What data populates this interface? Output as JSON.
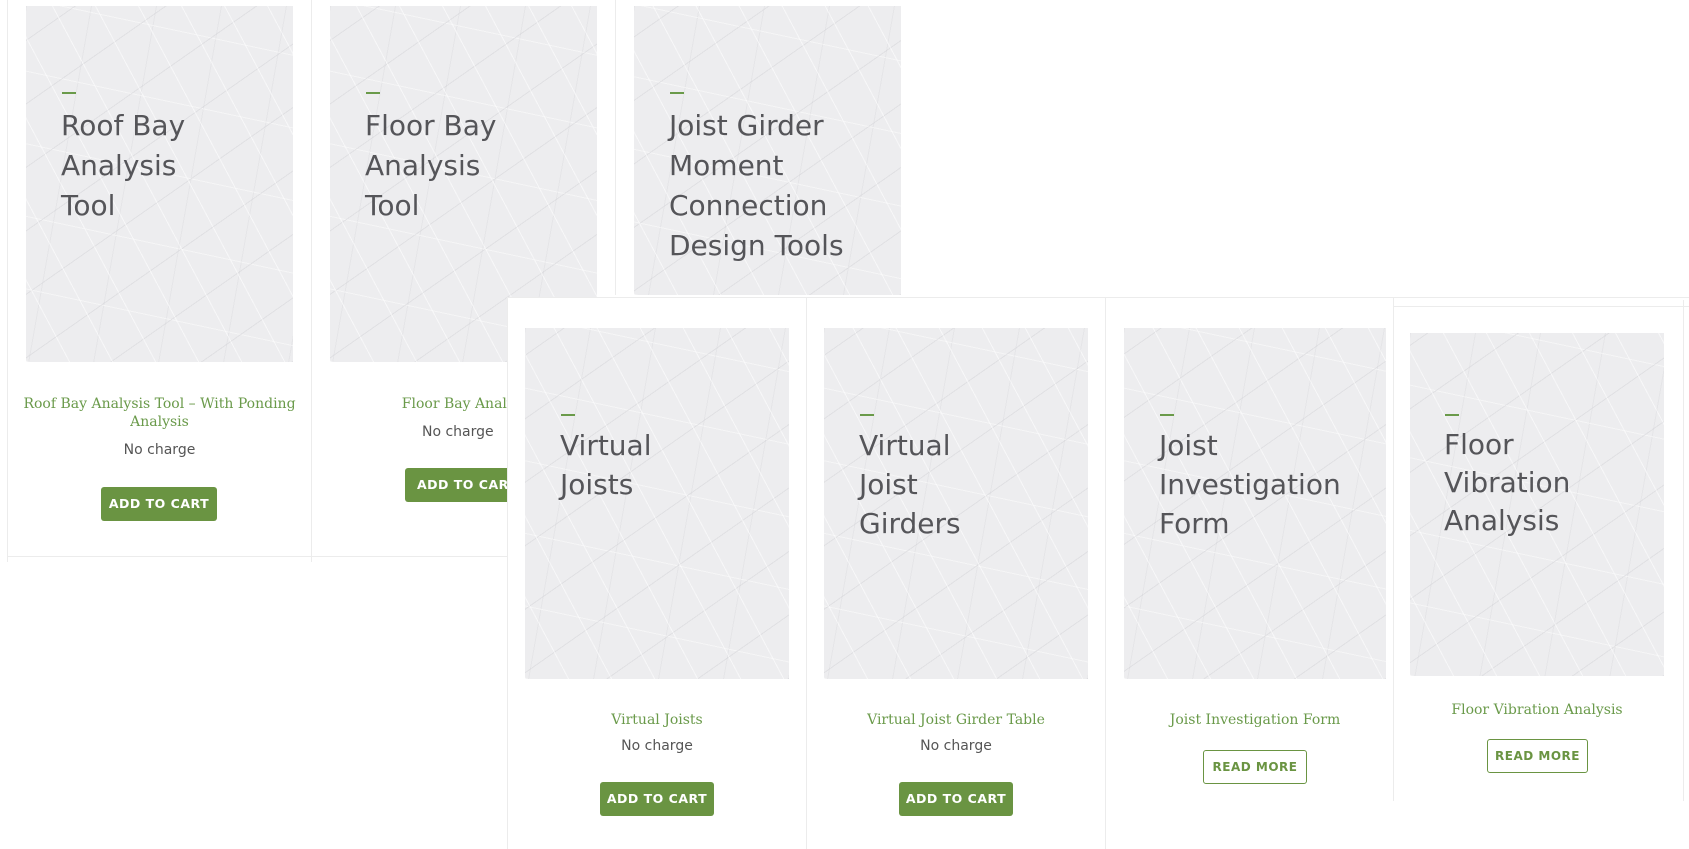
{
  "accent_color": "#6a9442",
  "products": [
    {
      "thumb_lines": [
        "Roof Bay",
        "Analysis",
        "Tool"
      ],
      "title": "Roof Bay Analysis Tool – With Ponding Analysis",
      "price": "No charge",
      "button": "ADD TO CART"
    },
    {
      "thumb_lines": [
        "Floor Bay",
        "Analysis",
        "Tool"
      ],
      "title": "Floor Bay Analys",
      "price": "No charge",
      "button": "ADD TO CAR"
    },
    {
      "thumb_lines": [
        "Joist Girder",
        "Moment",
        "Connection",
        "Design Tools"
      ]
    },
    {
      "thumb_lines": [
        "Virtual",
        "Joists"
      ],
      "title": "Virtual Joists",
      "price": "No charge",
      "button": "ADD TO CART"
    },
    {
      "thumb_lines": [
        "Virtual",
        "Joist",
        "Girders"
      ],
      "title": "Virtual Joist Girder Table",
      "price": "No charge",
      "button": "ADD TO CART"
    },
    {
      "thumb_lines": [
        "Joist",
        "Investigation",
        "Form"
      ],
      "title": "Joist Investigation Form",
      "button": "READ MORE"
    },
    {
      "thumb_lines": [
        "Floor",
        "Vibration",
        "Analysis"
      ],
      "title": "Floor Vibration Analysis",
      "button": "READ MORE"
    }
  ]
}
